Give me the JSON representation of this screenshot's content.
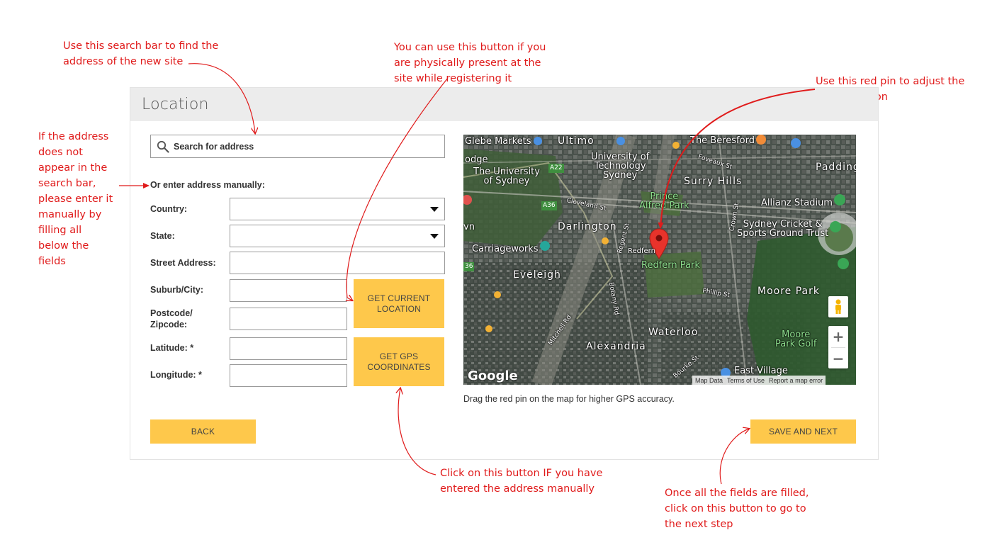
{
  "annotations": {
    "search_bar": "Use this search bar to find the\naddress of the new site",
    "current_location": "You can use this button if you\nare physically present at the\nsite while registering it",
    "red_pin": "Use this red pin to adjust the\nexact location",
    "manual_entry": "If the address\ndoes not\nappear in the\nsearch bar,\nplease enter it\nmanually by\nfilling all\nbelow the\nfields",
    "gps_button": "Click on this button IF you have\nentered the address manually",
    "save_next": "Once all the fields are filled,\nclick on this button to go to\nthe next step"
  },
  "form": {
    "title": "Location",
    "search": {
      "placeholder": "Search for address",
      "icon": "search-icon"
    },
    "manual_label": "Or enter address manually:",
    "fields": {
      "country": {
        "label": "Country:",
        "value": ""
      },
      "state": {
        "label": "State:",
        "value": ""
      },
      "street": {
        "label": "Street Address:",
        "value": ""
      },
      "suburb": {
        "label": "Suburb/City:",
        "value": ""
      },
      "postcode": {
        "label": "Postcode/\nZipcode:",
        "value": ""
      },
      "latitude": {
        "label": "Latitude: *",
        "value": ""
      },
      "longitude": {
        "label": "Longitude: *",
        "value": ""
      }
    },
    "buttons": {
      "current_location": "GET CURRENT\nLOCATION",
      "gps": "GET GPS\nCOORDINATES",
      "back": "BACK",
      "save_next": "SAVE AND NEXT"
    },
    "map_caption": "Drag the red pin on the map for higher GPS accuracy.",
    "accent_color": "#fec84b"
  },
  "map": {
    "labels": {
      "glebe_markets": "Glebe Markets",
      "ultimo": "Ultimo",
      "beresford": "The Beresford",
      "odge": "odge",
      "uni_tech": "University of\nTechnology\nSydney",
      "uni_sydney": "The University\nof Sydney",
      "padding": "Padding",
      "surry_hills": "Surry Hills",
      "prince_alfred": "Prince\nAlfred Park",
      "allianz": "Allianz Stadium",
      "darlington": "Darlington",
      "scg": "Sydney Cricket &\nSports Ground Trust",
      "carriageworks": "Carriageworks",
      "redfern_park": "Redfern Park",
      "redfern": "Redfern",
      "eveleigh": "Eveleigh",
      "moore_park": "Moore Park",
      "waterloo": "Waterloo",
      "moore_park_golf": "Moore\nPark Golf",
      "alexandria": "Alexandria",
      "east_village": "East Village",
      "a22": "A22",
      "a36": "A36",
      "r36": "36",
      "cleveland": "Cleveland St",
      "regent": "Regent St",
      "botany": "Botany Rd",
      "mitchell": "Mitchell Rd",
      "phillip": "Phillip St",
      "crown": "Crown St",
      "foveaux": "Foveaux St",
      "bourke": "Bourke St",
      "vn": "vn"
    },
    "zoom_in": "+",
    "zoom_out": "−",
    "logo": "Google",
    "footer": {
      "map_data": "Map Data",
      "terms": "Terms of Use",
      "report": "Report a map error"
    }
  }
}
